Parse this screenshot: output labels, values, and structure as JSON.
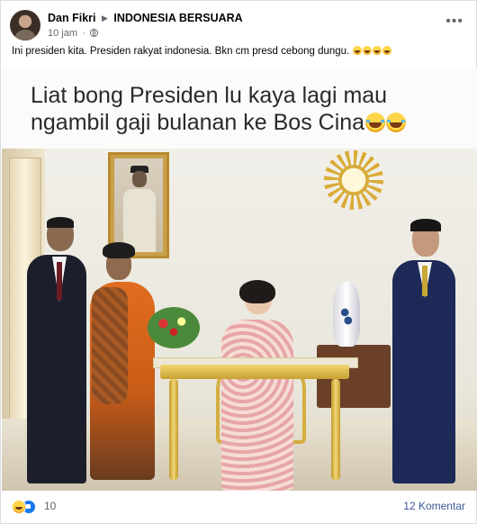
{
  "post": {
    "author": "Dan Fikri",
    "group": "INDONESIA BERSUARA",
    "time": "10 jam",
    "caption": "Ini presiden kita. Presiden rakyat indonesia. Bkn cm presd cebong dungu.",
    "caption_emojis": [
      "laughing-emoji",
      "laughing-emoji",
      "laughing-emoji",
      "laughing-emoji"
    ],
    "more_label": "•••"
  },
  "image": {
    "meme_line1": "Liat bong Presiden lu kaya lagi mau",
    "meme_line2": "ngambil gaji bulanan ke Bos Cina"
  },
  "footer": {
    "reaction_count": "10",
    "comments": "12 Komentar"
  },
  "colors": {
    "link": "#3b5998",
    "muted": "#65676b",
    "like_blue": "#1877f2"
  }
}
